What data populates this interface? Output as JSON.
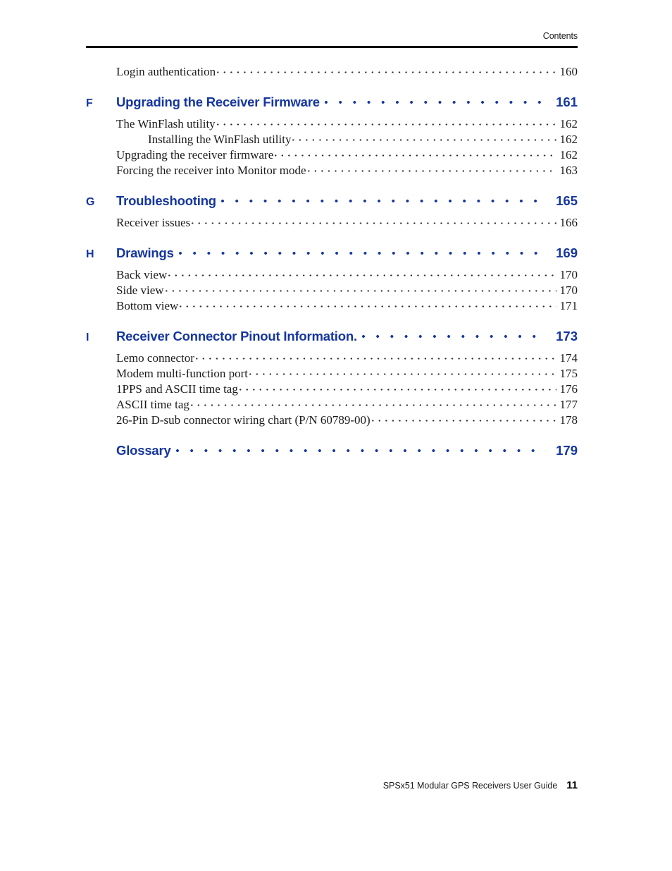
{
  "header": {
    "running_head": "Contents"
  },
  "toc": {
    "rows": [
      {
        "kind": "entry",
        "indent": 0,
        "letter": "",
        "title": "Login authentication",
        "page": "160"
      },
      {
        "kind": "chapter",
        "indent": 0,
        "letter": "F",
        "title": "Upgrading the Receiver Firmware",
        "page": "161"
      },
      {
        "kind": "entry",
        "indent": 0,
        "letter": "",
        "title": "The WinFlash utility",
        "page": "162"
      },
      {
        "kind": "entry",
        "indent": 1,
        "letter": "",
        "title": "Installing the WinFlash utility",
        "page": "162"
      },
      {
        "kind": "entry",
        "indent": 0,
        "letter": "",
        "title": "Upgrading the receiver firmware",
        "page": "162"
      },
      {
        "kind": "entry",
        "indent": 0,
        "letter": "",
        "title": "Forcing the receiver into Monitor mode",
        "page": "163"
      },
      {
        "kind": "chapter",
        "indent": 0,
        "letter": "G",
        "title": "Troubleshooting",
        "page": "165"
      },
      {
        "kind": "entry",
        "indent": 0,
        "letter": "",
        "title": "Receiver issues",
        "page": "166"
      },
      {
        "kind": "chapter",
        "indent": 0,
        "letter": "H",
        "title": "Drawings",
        "page": "169"
      },
      {
        "kind": "entry",
        "indent": 0,
        "letter": "",
        "title": "Back view",
        "page": "170"
      },
      {
        "kind": "entry",
        "indent": 0,
        "letter": "",
        "title": "Side view",
        "page": "170"
      },
      {
        "kind": "entry",
        "indent": 0,
        "letter": "",
        "title": "Bottom view",
        "page": "171"
      },
      {
        "kind": "chapter",
        "indent": 0,
        "letter": "I",
        "title": "Receiver Connector Pinout Information.",
        "page": "173"
      },
      {
        "kind": "entry",
        "indent": 0,
        "letter": "",
        "title": "Lemo connector",
        "page": "174"
      },
      {
        "kind": "entry",
        "indent": 0,
        "letter": "",
        "title": "Modem multi-function port",
        "page": "175"
      },
      {
        "kind": "entry",
        "indent": 0,
        "letter": "",
        "title": "1PPS and ASCII time tag",
        "page": "176"
      },
      {
        "kind": "entry",
        "indent": 0,
        "letter": "",
        "title": "ASCII time tag",
        "page": "177"
      },
      {
        "kind": "entry",
        "indent": 0,
        "letter": "",
        "title": "26-Pin D-sub connector wiring chart (P/N 60789-00)",
        "page": "178"
      },
      {
        "kind": "chapter",
        "indent": 0,
        "letter": "",
        "title": "Glossary",
        "page": "179"
      }
    ]
  },
  "footer": {
    "guide_title": "SPSx51 Modular GPS Receivers User Guide",
    "folio": "11"
  },
  "colors": {
    "heading_blue": "#15369f",
    "body_text": "#1a1a1a",
    "rule": "#000000",
    "background": "#ffffff"
  }
}
